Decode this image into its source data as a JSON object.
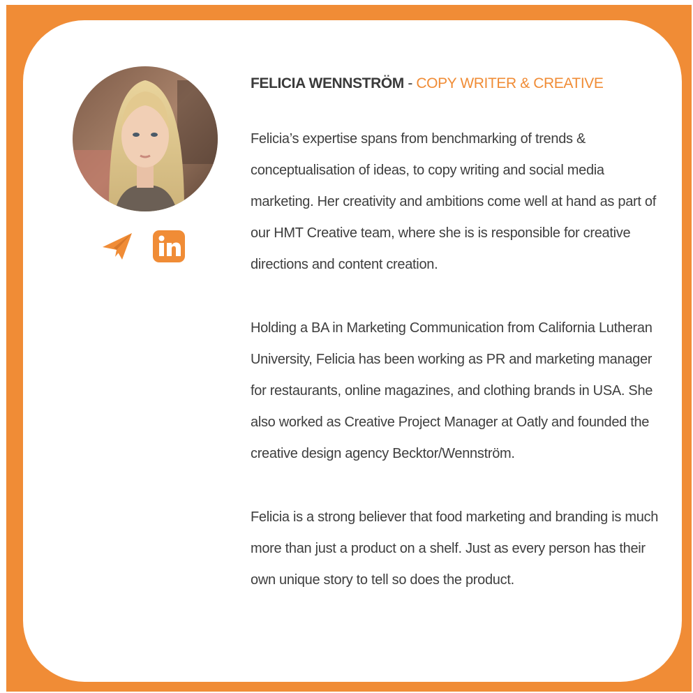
{
  "profile": {
    "name": "FELICIA WENNSTRÖM",
    "separator": " - ",
    "role": "COPY WRITER & CREATIVE",
    "paragraphs": [
      "Felicia’s expertise spans from benchmarking of trends & conceptualisation of ideas, to copy writing and social media marketing. Her creativity and ambitions come well at hand as part of our HMT Creative team, where she is  is responsible for creative directions and content creation.",
      "Holding a BA in Marketing Communication from California Lutheran University, Felicia has been working as PR and marketing manager for restaurants, online magazines, and clothing brands in USA. She also worked as Creative Project Manager at Oatly and founded the creative design agency Becktor/Wennström.",
      "Felicia is a strong believer that food marketing and branding is much more than just a product on a shelf. Just as every person has their own unique story to tell so does the product."
    ]
  },
  "icons": {
    "email": "paper-plane-icon",
    "linkedin": "linkedin-icon"
  },
  "colors": {
    "accent": "#f08c36",
    "text": "#3e3e3e",
    "card": "#ffffff"
  }
}
